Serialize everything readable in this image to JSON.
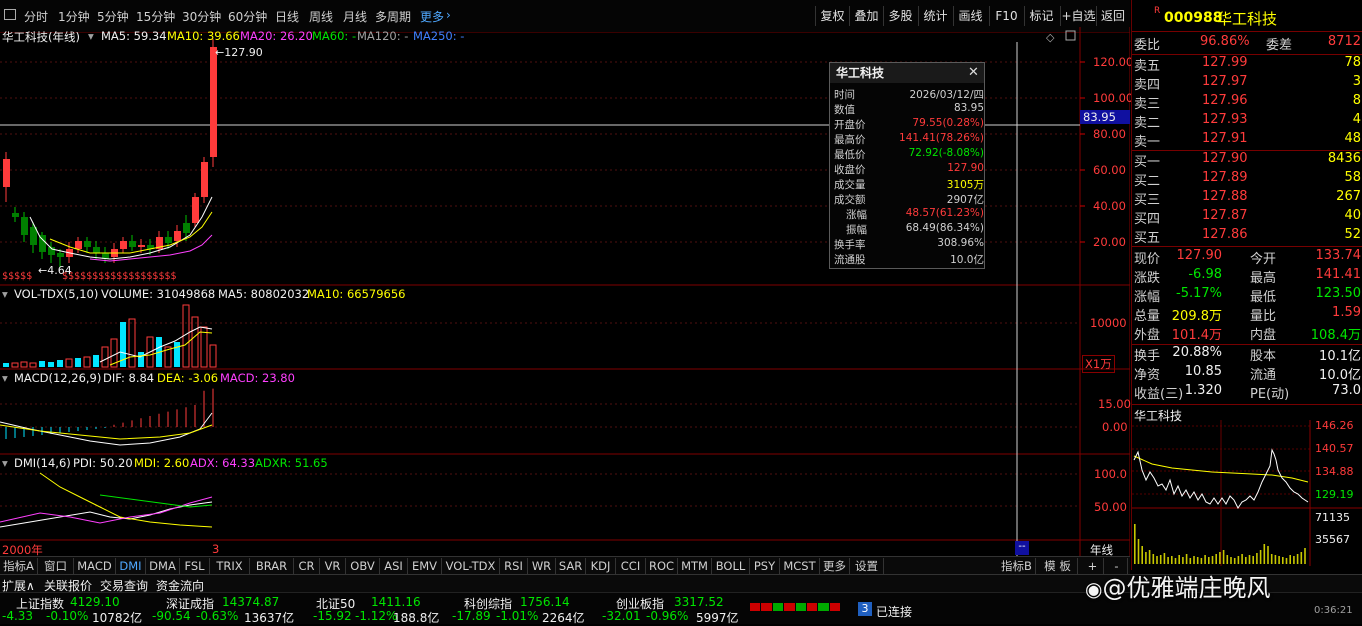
{
  "periods": [
    "分时",
    "1分钟",
    "5分钟",
    "15分钟",
    "30分钟",
    "60分钟",
    "日线",
    "周线",
    "月线",
    "多周期",
    "更多"
  ],
  "toolbar": [
    "复权",
    "叠加",
    "多股",
    "统计",
    "画线",
    "F10",
    "标记",
    "+自选",
    "返回"
  ],
  "chart": {
    "stock_label": "华工科技(年线)",
    "ma5": "MA5: 59.34",
    "ma10": "MA10: 39.66",
    "ma20": "MA20: 26.20",
    "ma60": "MA60: -",
    "ma120": "MA120: -",
    "ma250": "MA250: -",
    "high_mark": "127.90",
    "low_mark": "4.64",
    "cross_price": "83.95",
    "price_ticks": [
      "120.00",
      "100.00",
      "80.00",
      "60.00",
      "40.00",
      "20.00"
    ],
    "vol_header": "VOL-TDX(5,10)",
    "vol_value": "VOLUME: 31049868",
    "vol_ma5": "MA5: 80802032",
    "vol_ma10": "MA10: 66579656",
    "vol_tick": "10000",
    "vol_unit": "X1万",
    "macd_header": "MACD(12,26,9)",
    "macd_dif": "DIF: 8.84",
    "macd_dea": "DEA: -3.06",
    "macd_macd": "MACD: 23.80",
    "macd_ticks": [
      "15.00",
      "0.00"
    ],
    "dmi_header": "DMI(14,6)",
    "dmi_pdi": "PDI: 50.20",
    "dmi_mdi": "MDI: 2.60",
    "dmi_adx": "ADX: 64.33",
    "dmi_adxr": "ADXR: 51.65",
    "dmi_ticks": [
      "100.0",
      "50.00"
    ],
    "date_left": "2000年",
    "date_mark": "3",
    "year_label": "年线"
  },
  "tooltip": {
    "title": "华工科技",
    "rows": [
      {
        "label": "时间",
        "value": "2026/03/12/四",
        "color": "#d0d0d0"
      },
      {
        "label": "数值",
        "value": "83.95",
        "color": "#d0d0d0"
      },
      {
        "label": "开盘价",
        "value": "79.55(0.28%)",
        "color": "#ff3b3b"
      },
      {
        "label": "最高价",
        "value": "141.41(78.26%)",
        "color": "#ff3b3b"
      },
      {
        "label": "最低价",
        "value": "72.92(-8.08%)",
        "color": "#00e600"
      },
      {
        "label": "收盘价",
        "value": "127.90",
        "color": "#ff3b3b"
      },
      {
        "label": "成交量",
        "value": "3105万",
        "color": "#ffff00"
      },
      {
        "label": "成交额",
        "value": "2907亿",
        "color": "#d0d0d0"
      },
      {
        "label": "涨幅",
        "value": "48.57(61.23%)",
        "color": "#ff3b3b"
      },
      {
        "label": "振幅",
        "value": "68.49(86.34%)",
        "color": "#d0d0d0"
      },
      {
        "label": "换手率",
        "value": "308.96%",
        "color": "#d0d0d0"
      },
      {
        "label": "流通股",
        "value": "10.0亿",
        "color": "#d0d0d0"
      }
    ]
  },
  "quote": {
    "badge": "R",
    "code": "000988",
    "name": "华工科技",
    "weibi_label": "委比",
    "weibi_value": "96.86%",
    "weicha_label": "委差",
    "weicha_value": "8712",
    "asks": [
      {
        "label": "卖五",
        "price": "127.99",
        "vol": "78"
      },
      {
        "label": "卖四",
        "price": "127.97",
        "vol": "3"
      },
      {
        "label": "卖三",
        "price": "127.96",
        "vol": "8"
      },
      {
        "label": "卖二",
        "price": "127.93",
        "vol": "4"
      },
      {
        "label": "卖一",
        "price": "127.91",
        "vol": "48"
      }
    ],
    "bids": [
      {
        "label": "买一",
        "price": "127.90",
        "vol": "8436"
      },
      {
        "label": "买二",
        "price": "127.89",
        "vol": "58"
      },
      {
        "label": "买三",
        "price": "127.88",
        "vol": "267"
      },
      {
        "label": "买四",
        "price": "127.87",
        "vol": "40"
      },
      {
        "label": "买五",
        "price": "127.86",
        "vol": "52"
      }
    ],
    "stats": [
      {
        "l1": "现价",
        "v1": "127.90",
        "c1": "#ff3b3b",
        "l2": "今开",
        "v2": "133.74",
        "c2": "#ff3b3b"
      },
      {
        "l1": "涨跌",
        "v1": "-6.98",
        "c1": "#00e600",
        "l2": "最高",
        "v2": "141.41",
        "c2": "#ff3b3b"
      },
      {
        "l1": "涨幅",
        "v1": "-5.17%",
        "c1": "#00e600",
        "l2": "最低",
        "v2": "123.50",
        "c2": "#00e600"
      },
      {
        "l1": "总量",
        "v1": "209.8万",
        "c1": "#ffff00",
        "l2": "量比",
        "v2": "1.59",
        "c2": "#ff3b3b"
      },
      {
        "l1": "外盘",
        "v1": "101.4万",
        "c1": "#ff3b3b",
        "l2": "内盘",
        "v2": "108.4万",
        "c2": "#00e600"
      }
    ],
    "stats2": [
      {
        "l1": "换手",
        "v1": "20.88%",
        "l2": "股本",
        "v2": "10.1亿"
      },
      {
        "l1": "净资",
        "v1": "10.85",
        "l2": "流通",
        "v2": "10.0亿"
      },
      {
        "l1": "收益(三)",
        "v1": "1.320",
        "l2": "PE(动)",
        "v2": "73.0"
      }
    ],
    "mini_title": "华工科技",
    "mini_ticks": [
      "146.26",
      "140.57",
      "134.88",
      "129.19"
    ],
    "mini_vol_ticks": [
      "71135",
      "35567"
    ]
  },
  "indicator_tabs": [
    "指标A",
    "窗口",
    "MACD",
    "DMI",
    "DMA",
    "FSL",
    "TRIX",
    "BRAR",
    "CR",
    "VR",
    "OBV",
    "ASI",
    "EMV",
    "VOL-TDX",
    "RSI",
    "WR",
    "SAR",
    "KDJ",
    "CCI",
    "ROC",
    "MTM",
    "BOLL",
    "PSY",
    "MCST",
    "更多",
    "设置"
  ],
  "indicator_b": "指标B",
  "model": "模 板",
  "bottom_links": [
    "扩展∧",
    "关联报价",
    "交易查询",
    "资金流向"
  ],
  "indices": [
    {
      "name": "上证指数",
      "value": "4129.10",
      "chg": "-4.33",
      "pct": "-0.10%",
      "amt": "10782亿"
    },
    {
      "name": "深证成指",
      "value": "14374.87",
      "chg": "-90.54",
      "pct": "-0.63%",
      "amt": "13637亿"
    },
    {
      "name": "北证50",
      "value": "1411.16",
      "chg": "-15.92",
      "pct": "-1.12%",
      "amt": "188.8亿"
    },
    {
      "name": "科创综指",
      "value": "1756.14",
      "chg": "-17.89",
      "pct": "-1.01%",
      "amt": "2264亿"
    },
    {
      "name": "创业板指",
      "value": "3317.52",
      "chg": "-32.01",
      "pct": "-0.96%",
      "amt": "5997亿"
    }
  ],
  "conn_badge": "3",
  "conn_text": "已连接",
  "watermark": "@优雅端庄晚风",
  "time_small": "0:36:21",
  "colors": {
    "up": "#ff3b3b",
    "down": "#00e600",
    "ma5": "#ffffff",
    "ma10": "#ffff00",
    "ma20": "#ff40ff",
    "bg": "#000000"
  }
}
